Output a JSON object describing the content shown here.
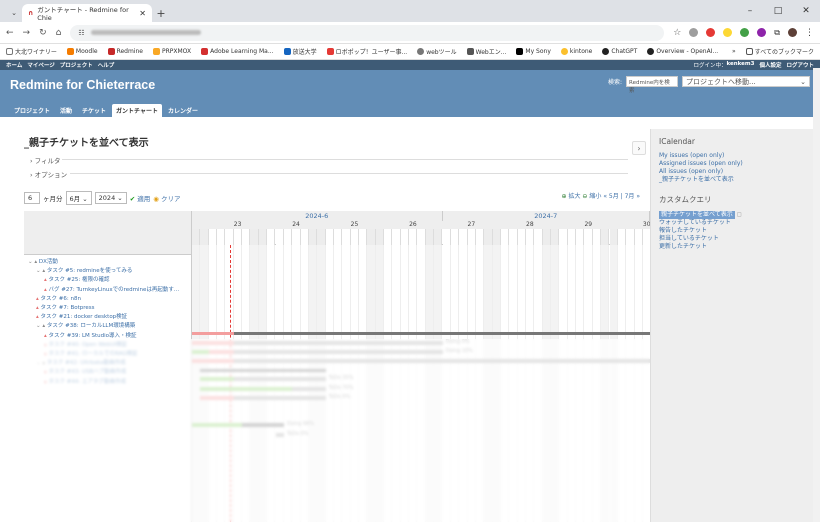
{
  "browser": {
    "tab_title": "ガントチャート - Redmine for Chie",
    "new_tab": "+",
    "window_controls": [
      "–",
      "□",
      "✕"
    ],
    "bookmarks": [
      "大北ワイナリー",
      "Moodle",
      "Redmine",
      "PRPXMOX",
      "Adobe Learning Ma...",
      "放送大学",
      "ロボポップ！ユーザー事...",
      "webツール",
      "Webエン...",
      "My Sony",
      "kintone",
      "ChatGPT",
      "Overview - OpenAI...",
      "»",
      "すべてのブックマーク"
    ]
  },
  "topbar": {
    "left": [
      "ホーム",
      "マイページ",
      "プロジェクト",
      "ヘルプ"
    ],
    "right": [
      "ログイン中：",
      "kenkem3",
      "個人設定",
      "ログアウト"
    ]
  },
  "header": {
    "title": "Redmine for Chieterrace",
    "search_label": "検索:",
    "search_placeholder": "Redmine内を検索",
    "project_jump": "プロジェクトへ移動...",
    "menu": [
      "プロジェクト",
      "活動",
      "チケット",
      "ガントチャート",
      "カレンダー"
    ]
  },
  "page": {
    "title": "_親子チケットを並べて表示",
    "filter": "フィルタ",
    "options": "オプション"
  },
  "controls": {
    "months_value": "6",
    "months_label": "ヶ月分",
    "month": "6月",
    "year": "2024",
    "apply": "適用",
    "clear": "クリア",
    "zoom_in": "拡大",
    "zoom_out": "縮小",
    "prev": "« 5月",
    "next": "7月 »",
    "sep": "|"
  },
  "gantt": {
    "months": [
      "2024-6",
      "2024-7"
    ],
    "weeks": [
      "23",
      "24",
      "25",
      "26",
      "27",
      "28",
      "29",
      "30"
    ],
    "issues": [
      {
        "text": "DX活動",
        "level": 0,
        "group": true
      },
      {
        "text": "タスク #5: redmineを使ってみる",
        "level": 1,
        "group": true
      },
      {
        "text": "タスク #25: 権限の確認",
        "level": 2
      },
      {
        "text": "バグ #27: TurnkeyLinuxでのredmineは再起動す...",
        "level": 2
      },
      {
        "text": "タスク #6: n8n",
        "level": 1
      },
      {
        "text": "タスク #7: Botpress",
        "level": 1
      },
      {
        "text": "タスク #21: docker desktop検証",
        "level": 1
      },
      {
        "text": "タスク #38: ローカルLLM環境構築",
        "level": 1,
        "group": true
      },
      {
        "text": "タスク #39: LM Studio導入・検証",
        "level": 2
      },
      {
        "text": "タスク #40: Open WebUI検証",
        "level": 2
      },
      {
        "text": "タスク #41: ローカルでのRAG検証",
        "level": 2
      },
      {
        "text": "タスク #42: Ultrbaka動画作成",
        "level": 1,
        "group": true
      },
      {
        "text": "タスク #43: USBハブ動画作成",
        "level": 2
      },
      {
        "text": "タスク #44: エアタグ動画作成",
        "level": 2
      }
    ],
    "bar_labels": [
      "Doing 0%",
      "Doing 10%",
      "ToDo 35%",
      "ToDo 70%",
      "ToDo 0%",
      "Doing 66%",
      "ToDo 0%"
    ]
  },
  "sidebar": {
    "ical_title": "ICalendar",
    "ical_links": [
      "My issues (open only)",
      "Assigned issues (open only)",
      "All issues (open only)",
      "_親子チケットを並べて表示"
    ],
    "query_title": "カスタムクエリ",
    "queries": [
      "親子チケットを並べて表示",
      "ウォッチしているチケット",
      "報告したチケット",
      "担当しているチケット",
      "更新したチケット"
    ]
  },
  "colors": {
    "header": "#628db6",
    "topbar": "#3e5b76",
    "late": "#f39e9e",
    "done": "#8fd36f",
    "todo": "#aaaaaa"
  }
}
